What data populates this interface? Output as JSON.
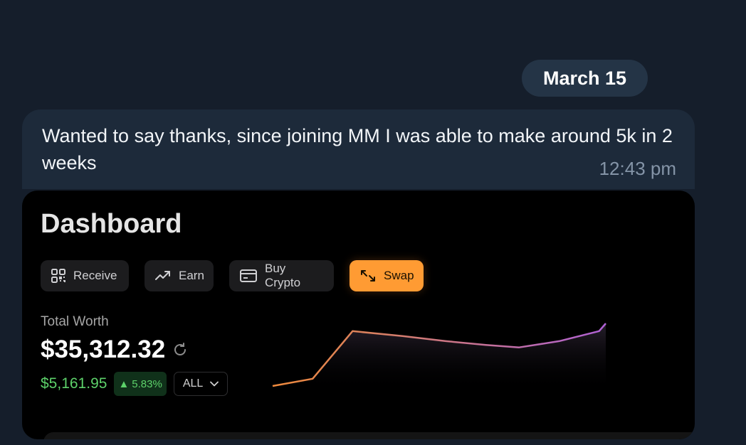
{
  "chat": {
    "date_label": "March 15",
    "message_text": "Wanted to say thanks, since joining MM I was able to make around 5k in 2 weeks",
    "message_time": "12:43 pm"
  },
  "dashboard": {
    "title": "Dashboard",
    "actions": [
      {
        "label": "Receive",
        "icon": "qr-code-icon"
      },
      {
        "label": "Earn",
        "icon": "trend-up-icon"
      },
      {
        "label": "Buy Crypto",
        "icon": "card-icon"
      },
      {
        "label": "Swap",
        "icon": "swap-arrows-icon"
      }
    ],
    "total_label": "Total Worth",
    "total_value": "$35,312.32",
    "change_amount": "$5,161.95",
    "change_percent": "5.83%",
    "range_value": "ALL",
    "colors": {
      "accent": "#ff9b33",
      "positive": "#5dd16a",
      "line_start": "#ef8a3c",
      "line_end": "#b061d6"
    }
  },
  "chart_data": {
    "type": "line",
    "series": [
      {
        "values": [
          30320,
          30900,
          34700,
          34300,
          33900,
          33600,
          33400,
          33900,
          34700,
          35312.32
        ]
      }
    ]
  }
}
